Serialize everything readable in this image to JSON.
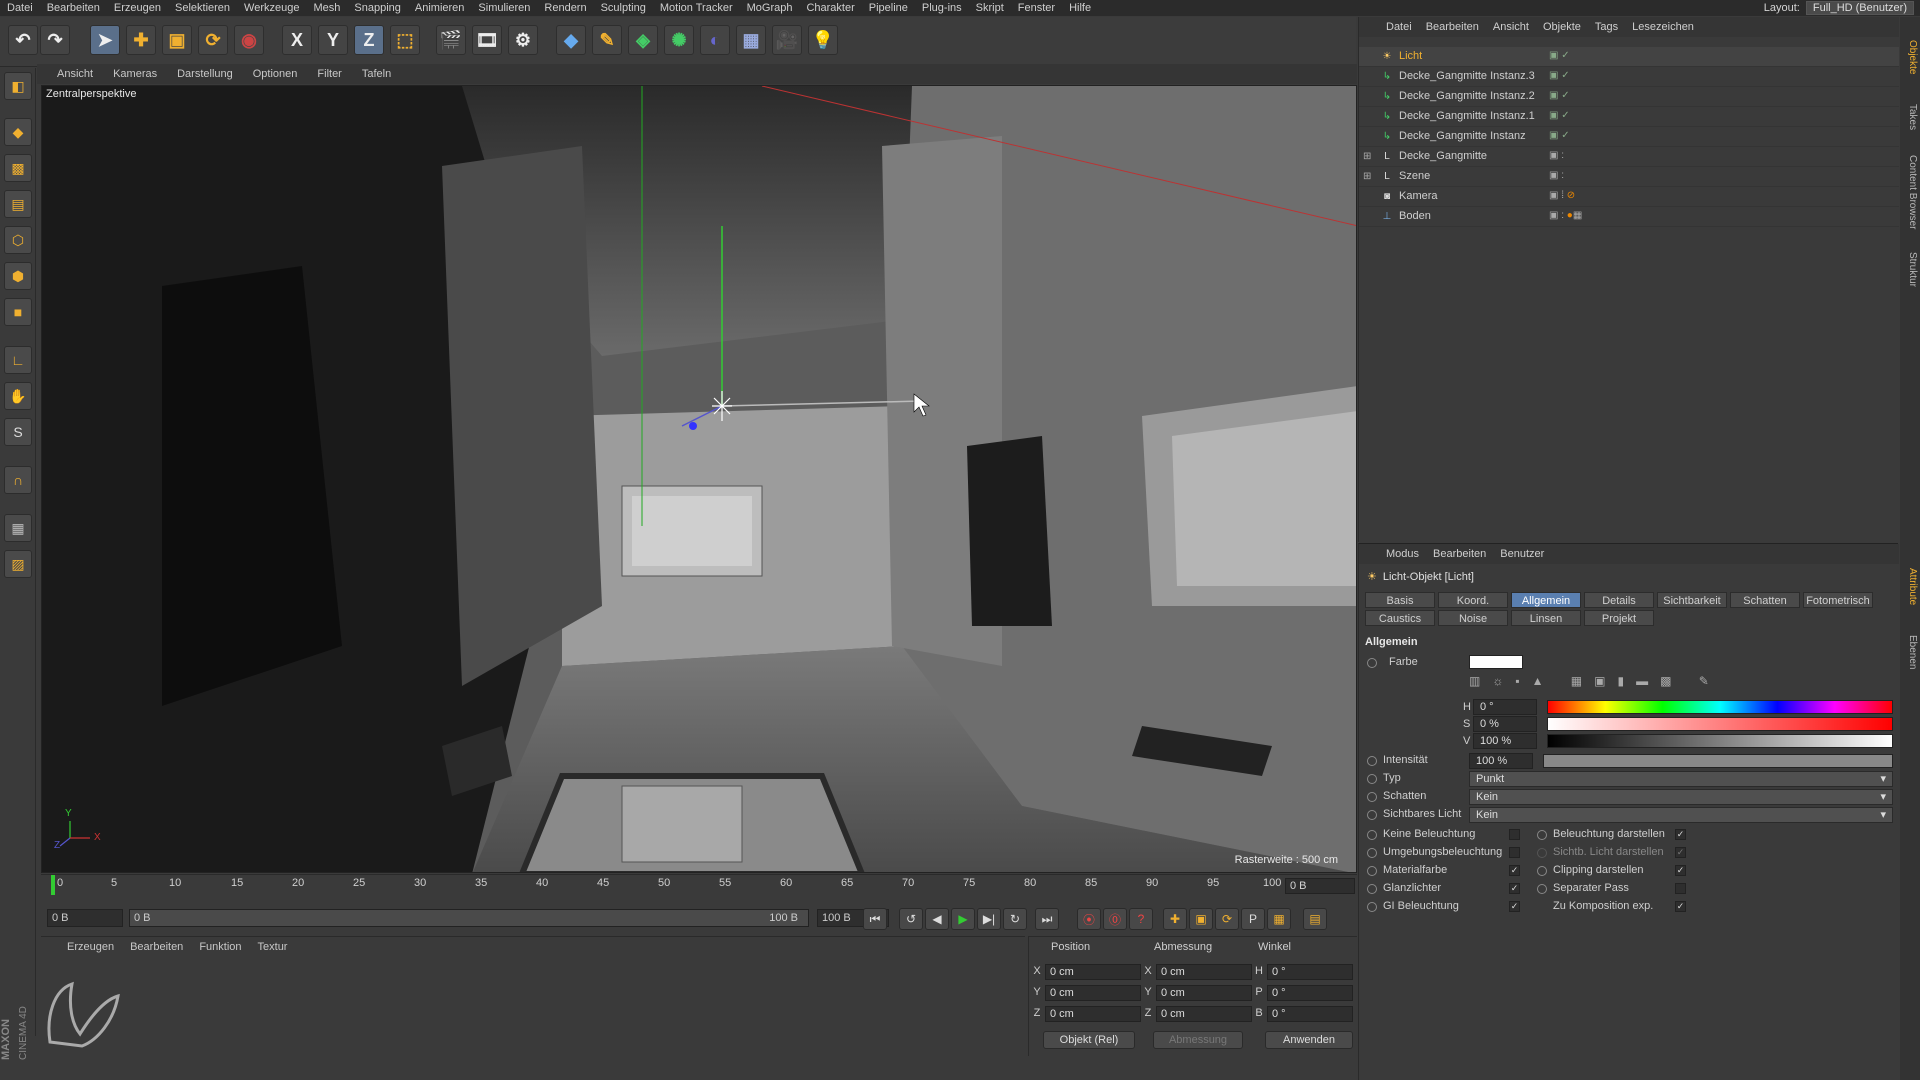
{
  "menubar": {
    "items": [
      "Datei",
      "Bearbeiten",
      "Erzeugen",
      "Selektieren",
      "Werkzeuge",
      "Mesh",
      "Snapping",
      "Animieren",
      "Simulieren",
      "Rendern",
      "Sculpting",
      "Motion Tracker",
      "MoGraph",
      "Charakter",
      "Pipeline",
      "Plug-ins",
      "Skript",
      "Fenster",
      "Hilfe"
    ],
    "layout_label": "Layout:",
    "layout_value": "Full_HD (Benutzer)"
  },
  "toolbar": {
    "axis_x": "X",
    "axis_y": "Y",
    "axis_z": "Z"
  },
  "viewport": {
    "menu": [
      "Ansicht",
      "Kameras",
      "Darstellung",
      "Optionen",
      "Filter",
      "Tafeln"
    ],
    "camera_label": "Zentralperspektive",
    "raster": "Rasterweite : 500 cm",
    "axis_y": "Y",
    "axis_z": "Z",
    "axis_x": "X"
  },
  "timeline": {
    "ticks": [
      "0",
      "5",
      "10",
      "15",
      "20",
      "25",
      "30",
      "35",
      "40",
      "45",
      "50",
      "55",
      "60",
      "65",
      "70",
      "75",
      "80",
      "85",
      "90",
      "95",
      "100"
    ],
    "current_frame": "0 B",
    "start_field": "0 B",
    "range_start": "0 B",
    "range_end": "100 B",
    "end_field": "100 B"
  },
  "material": {
    "menu": [
      "Erzeugen",
      "Bearbeiten",
      "Funktion",
      "Textur"
    ]
  },
  "coords": {
    "headers": [
      "Position",
      "Abmessung",
      "Winkel"
    ],
    "rows": [
      {
        "l1": "X",
        "v1": "0 cm",
        "l2": "X",
        "v2": "0 cm",
        "l3": "H",
        "v3": "0 °"
      },
      {
        "l1": "Y",
        "v1": "0 cm",
        "l2": "Y",
        "v2": "0 cm",
        "l3": "P",
        "v3": "0 °"
      },
      {
        "l1": "Z",
        "v1": "0 cm",
        "l2": "Z",
        "v2": "0 cm",
        "l3": "B",
        "v3": "0 °"
      }
    ],
    "mode_select": "Objekt (Rel)",
    "size_select": "Abmessung",
    "apply": "Anwenden"
  },
  "brand": {
    "line1": "MAXON",
    "line2": "CINEMA 4D"
  },
  "object_manager": {
    "menu": [
      "Datei",
      "Bearbeiten",
      "Ansicht",
      "Objekte",
      "Tags",
      "Lesezeichen"
    ],
    "objects": [
      {
        "name": "Licht",
        "icon": "light-icon",
        "active": true
      },
      {
        "name": "Decke_Gangmitte Instanz.3",
        "icon": "instance-icon"
      },
      {
        "name": "Decke_Gangmitte Instanz.2",
        "icon": "instance-icon"
      },
      {
        "name": "Decke_Gangmitte Instanz.1",
        "icon": "instance-icon"
      },
      {
        "name": "Decke_Gangmitte Instanz",
        "icon": "instance-icon"
      },
      {
        "name": "Decke_Gangmitte",
        "icon": "null-icon"
      },
      {
        "name": "Szene",
        "icon": "null-icon"
      },
      {
        "name": "Kamera",
        "icon": "camera-icon"
      },
      {
        "name": "Boden",
        "icon": "floor-icon"
      }
    ]
  },
  "side_tabs": [
    "Objekte",
    "Takes",
    "Content Browser",
    "Struktur",
    "Attribute",
    "Ebenen"
  ],
  "attributes": {
    "menu": [
      "Modus",
      "Bearbeiten",
      "Benutzer"
    ],
    "title": "Licht-Objekt [Licht]",
    "tabs_row1": [
      "Basis",
      "Koord.",
      "Allgemein",
      "Details",
      "Sichtbarkeit",
      "Schatten",
      "Fotometrisch"
    ],
    "tabs_row2": [
      "Caustics",
      "Noise",
      "Linsen",
      "Projekt"
    ],
    "active_tab": "Allgemein",
    "section": "Allgemein",
    "color_label": "Farbe",
    "color_value": "#ffffff",
    "h_label": "H",
    "h_value": "0 °",
    "s_label": "S",
    "s_value": "0 %",
    "v_label": "V",
    "v_value": "100 %",
    "intensity_label": "Intensität",
    "intensity_value": "100 %",
    "type_label": "Typ",
    "type_value": "Punkt",
    "shadow_label": "Schatten",
    "shadow_value": "Kein",
    "visible_label": "Sichtbares Licht",
    "visible_value": "Kein",
    "checks_left": [
      {
        "label": "Keine Beleuchtung",
        "checked": false
      },
      {
        "label": "Umgebungsbeleuchtung",
        "checked": false
      },
      {
        "label": "Materialfarbe",
        "checked": true
      },
      {
        "label": "Glanzlichter",
        "checked": true
      },
      {
        "label": "GI Beleuchtung",
        "checked": true
      }
    ],
    "checks_right": [
      {
        "label": "Beleuchtung darstellen",
        "checked": true
      },
      {
        "label": "Sichtb. Licht darstellen",
        "checked": true
      },
      {
        "label": "Clipping darstellen",
        "checked": true
      },
      {
        "label": "Separater Pass",
        "checked": false
      },
      {
        "label": "Zu Komposition exp.",
        "checked": true
      }
    ]
  }
}
